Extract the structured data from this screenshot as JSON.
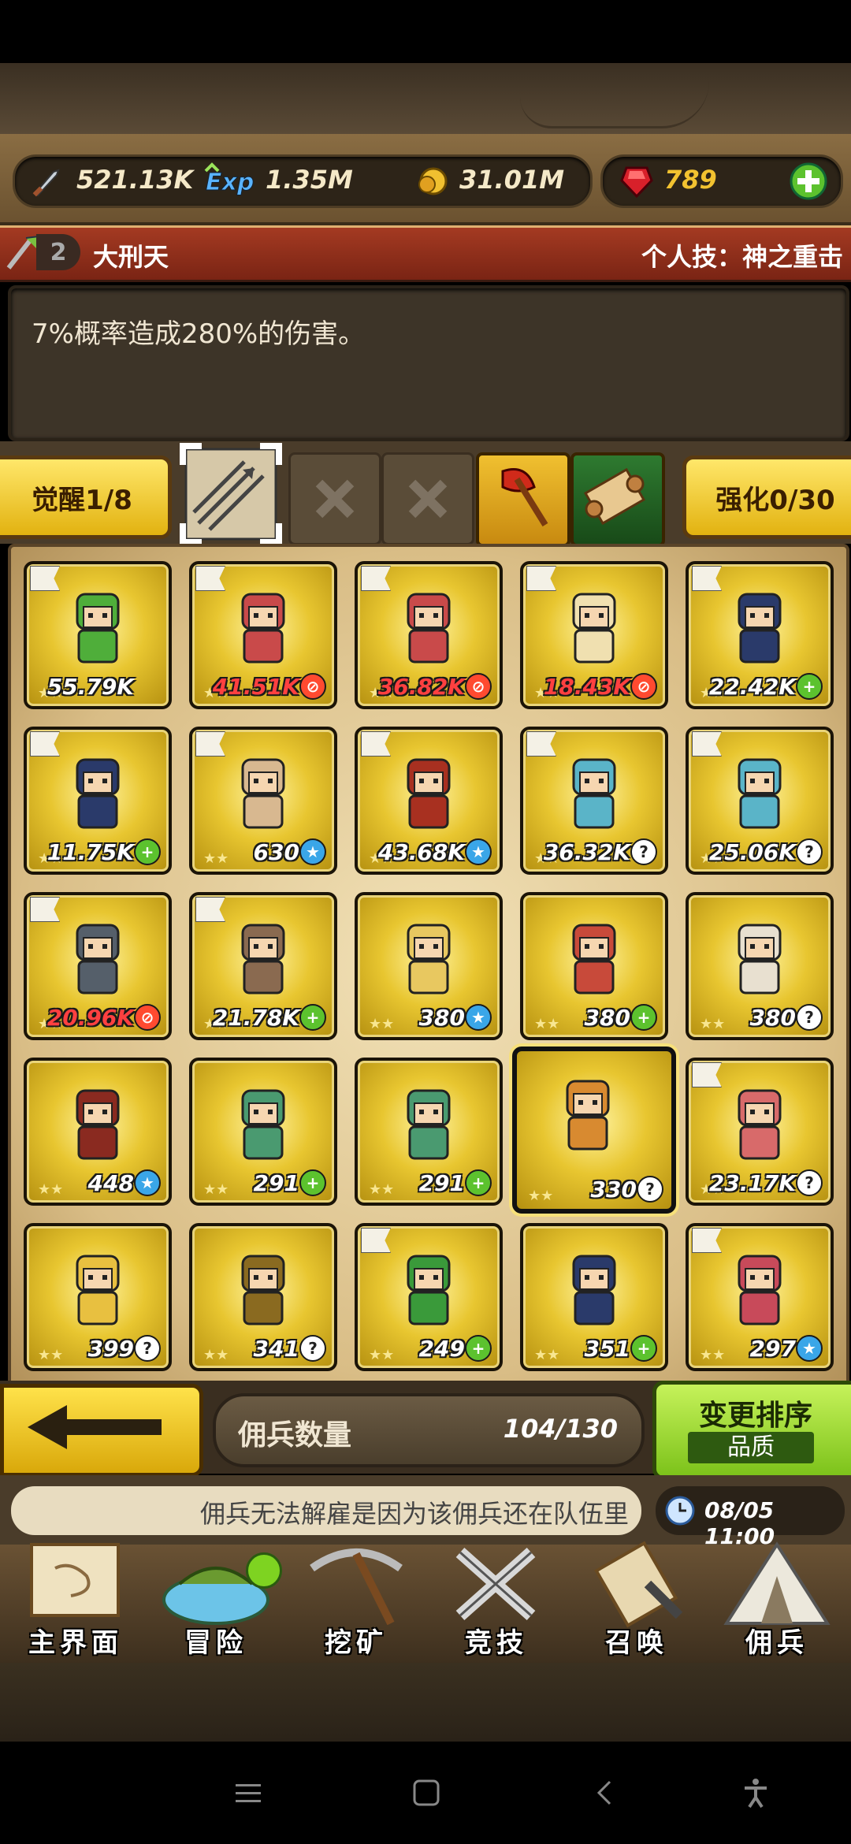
{
  "resources": {
    "attack": "521.13K",
    "exp": "1.35M",
    "gold": "31.01M",
    "gems": "789"
  },
  "hero_bar": {
    "level": "2",
    "name": "大刑天",
    "skill": "个人技：神之重击"
  },
  "description": "7%概率造成280%的伤害。",
  "skill_row": {
    "awaken": "觉醒1/8",
    "enhance": "强化0/30"
  },
  "cards": [
    {
      "value": "55.79K",
      "badge": "none",
      "red": false,
      "flag": true
    },
    {
      "value": "41.51K",
      "badge": "no",
      "red": true,
      "flag": true
    },
    {
      "value": "36.82K",
      "badge": "no",
      "red": true,
      "flag": true
    },
    {
      "value": "18.43K",
      "badge": "no",
      "red": true,
      "flag": true
    },
    {
      "value": "22.42K",
      "badge": "plus",
      "red": false,
      "flag": true
    },
    {
      "value": "11.75K",
      "badge": "plus",
      "red": false,
      "flag": true
    },
    {
      "value": "630",
      "badge": "star",
      "red": false,
      "flag": true
    },
    {
      "value": "43.68K",
      "badge": "star",
      "red": false,
      "flag": true
    },
    {
      "value": "36.32K",
      "badge": "q",
      "red": false,
      "flag": true
    },
    {
      "value": "25.06K",
      "badge": "q",
      "red": false,
      "flag": true
    },
    {
      "value": "20.96K",
      "badge": "no",
      "red": true,
      "flag": true
    },
    {
      "value": "21.78K",
      "badge": "plus",
      "red": false,
      "flag": true
    },
    {
      "value": "380",
      "badge": "star",
      "red": false,
      "flag": false
    },
    {
      "value": "380",
      "badge": "plus",
      "red": false,
      "flag": false
    },
    {
      "value": "380",
      "badge": "q",
      "red": false,
      "flag": false
    },
    {
      "value": "448",
      "badge": "star",
      "red": false,
      "flag": false
    },
    {
      "value": "291",
      "badge": "plus",
      "red": false,
      "flag": false
    },
    {
      "value": "291",
      "badge": "plus",
      "red": false,
      "flag": false
    },
    {
      "value": "330",
      "badge": "q",
      "red": false,
      "flag": false,
      "selected": true
    },
    {
      "value": "23.17K",
      "badge": "q",
      "red": false,
      "flag": true
    },
    {
      "value": "399",
      "badge": "q",
      "red": false,
      "flag": false
    },
    {
      "value": "341",
      "badge": "q",
      "red": false,
      "flag": false
    },
    {
      "value": "249",
      "badge": "plus",
      "red": false,
      "flag": true
    },
    {
      "value": "351",
      "badge": "plus",
      "red": false,
      "flag": false
    },
    {
      "value": "297",
      "badge": "star",
      "red": false,
      "flag": true
    }
  ],
  "bottom": {
    "count_label": "佣兵数量",
    "count_value": "104/130",
    "sort_title": "变更排序",
    "sort_sub": "品质"
  },
  "ticker": {
    "text": "佣兵无法解雇是因为该佣兵还在队伍里",
    "time": "08/05 11:00"
  },
  "nav": [
    "主界面",
    "冒险",
    "挖矿",
    "竞技",
    "召唤",
    "佣兵"
  ],
  "colors": {
    "accent": "#e2b210",
    "green": "#7cc21a",
    "red": "#a43a22"
  }
}
